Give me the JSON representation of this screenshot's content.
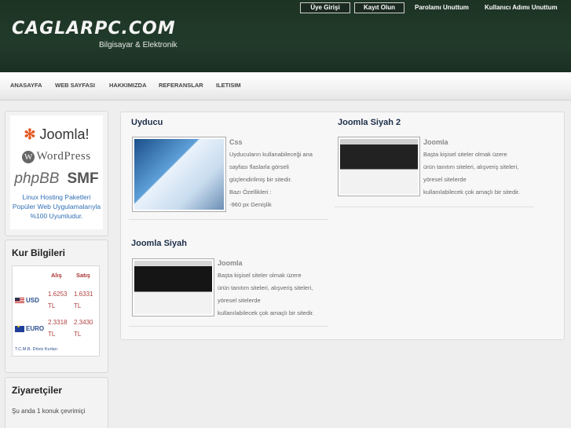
{
  "header": {
    "logo": "CAGLARPC.COM",
    "tagline": "Bilgisayar & Elektronik",
    "login_button": "Üye Girişi",
    "register_button": "Kayıt Olun",
    "forgot_password_link": "Parolamı Unuttum",
    "forgot_username_link": "Kullanıcı Adımı Unuttum"
  },
  "nav": {
    "items": [
      "ANASAYFA",
      "WEB SAYFASI",
      "HAKKIMIZDA",
      "REFERANSLAR",
      "ILETISIM"
    ]
  },
  "sidebar": {
    "logos": {
      "joomla": "Joomla!",
      "wordpress": "WordPress",
      "phpbb": "phpBB",
      "smf": "SMF"
    },
    "hosting_text": [
      "Linux Hosting Paketleri",
      "Popüler Web Uygulamalarıyla",
      "%100 Uyumludur."
    ],
    "kur": {
      "title": "Kur Bilgileri",
      "headers": [
        "Alış",
        "Satış"
      ],
      "rows": [
        {
          "currency": "USD",
          "buy": [
            "1.6253",
            "TL"
          ],
          "sell": [
            "1.6331",
            "TL"
          ]
        },
        {
          "currency": "EURO",
          "buy": [
            "2.3318",
            "TL"
          ],
          "sell": [
            "2.3430",
            "TL"
          ]
        }
      ],
      "footer": "T.C.M.B. Döviz Kurları"
    },
    "visitors": {
      "title": "Ziyaretçiler",
      "text": "Şu anda 1 konuk çevrimiçi"
    }
  },
  "main": {
    "cards": [
      {
        "title": "Uyducu",
        "subtitle": "Css",
        "lines": [
          "Uyducuların kullanabileceği ana",
          "sayfası flaslarla görseli",
          "güçlendirilmiş bir sitedir.",
          "Bazı Özellikleri :",
          "-960 px Genişlik"
        ]
      },
      {
        "title": "Joomla Siyah 2",
        "subtitle": "Joomla",
        "lines": [
          "Başta kişisel siteler olmak üzere",
          "ürün tanıtım siteleri, alışveriş siteleri,",
          "yöresel sitelerde",
          "kullanılabilecek çok amaçlı bir sitedir."
        ]
      },
      {
        "title": "Joomla Siyah",
        "subtitle": "Joomla",
        "lines": [
          "Başta kişisel siteler olmak üzere",
          "ürün tanıtım siteleri, alışveriş siteleri,",
          "yöresel sitelerde",
          "kullanılabilecek çok amaçlı bir sitedir."
        ]
      }
    ]
  },
  "colors": {
    "header_bg": "#213b2a",
    "title_blue": "#1c2e4a",
    "link_blue": "#2f6fb5",
    "rate_red": "#b04040"
  }
}
